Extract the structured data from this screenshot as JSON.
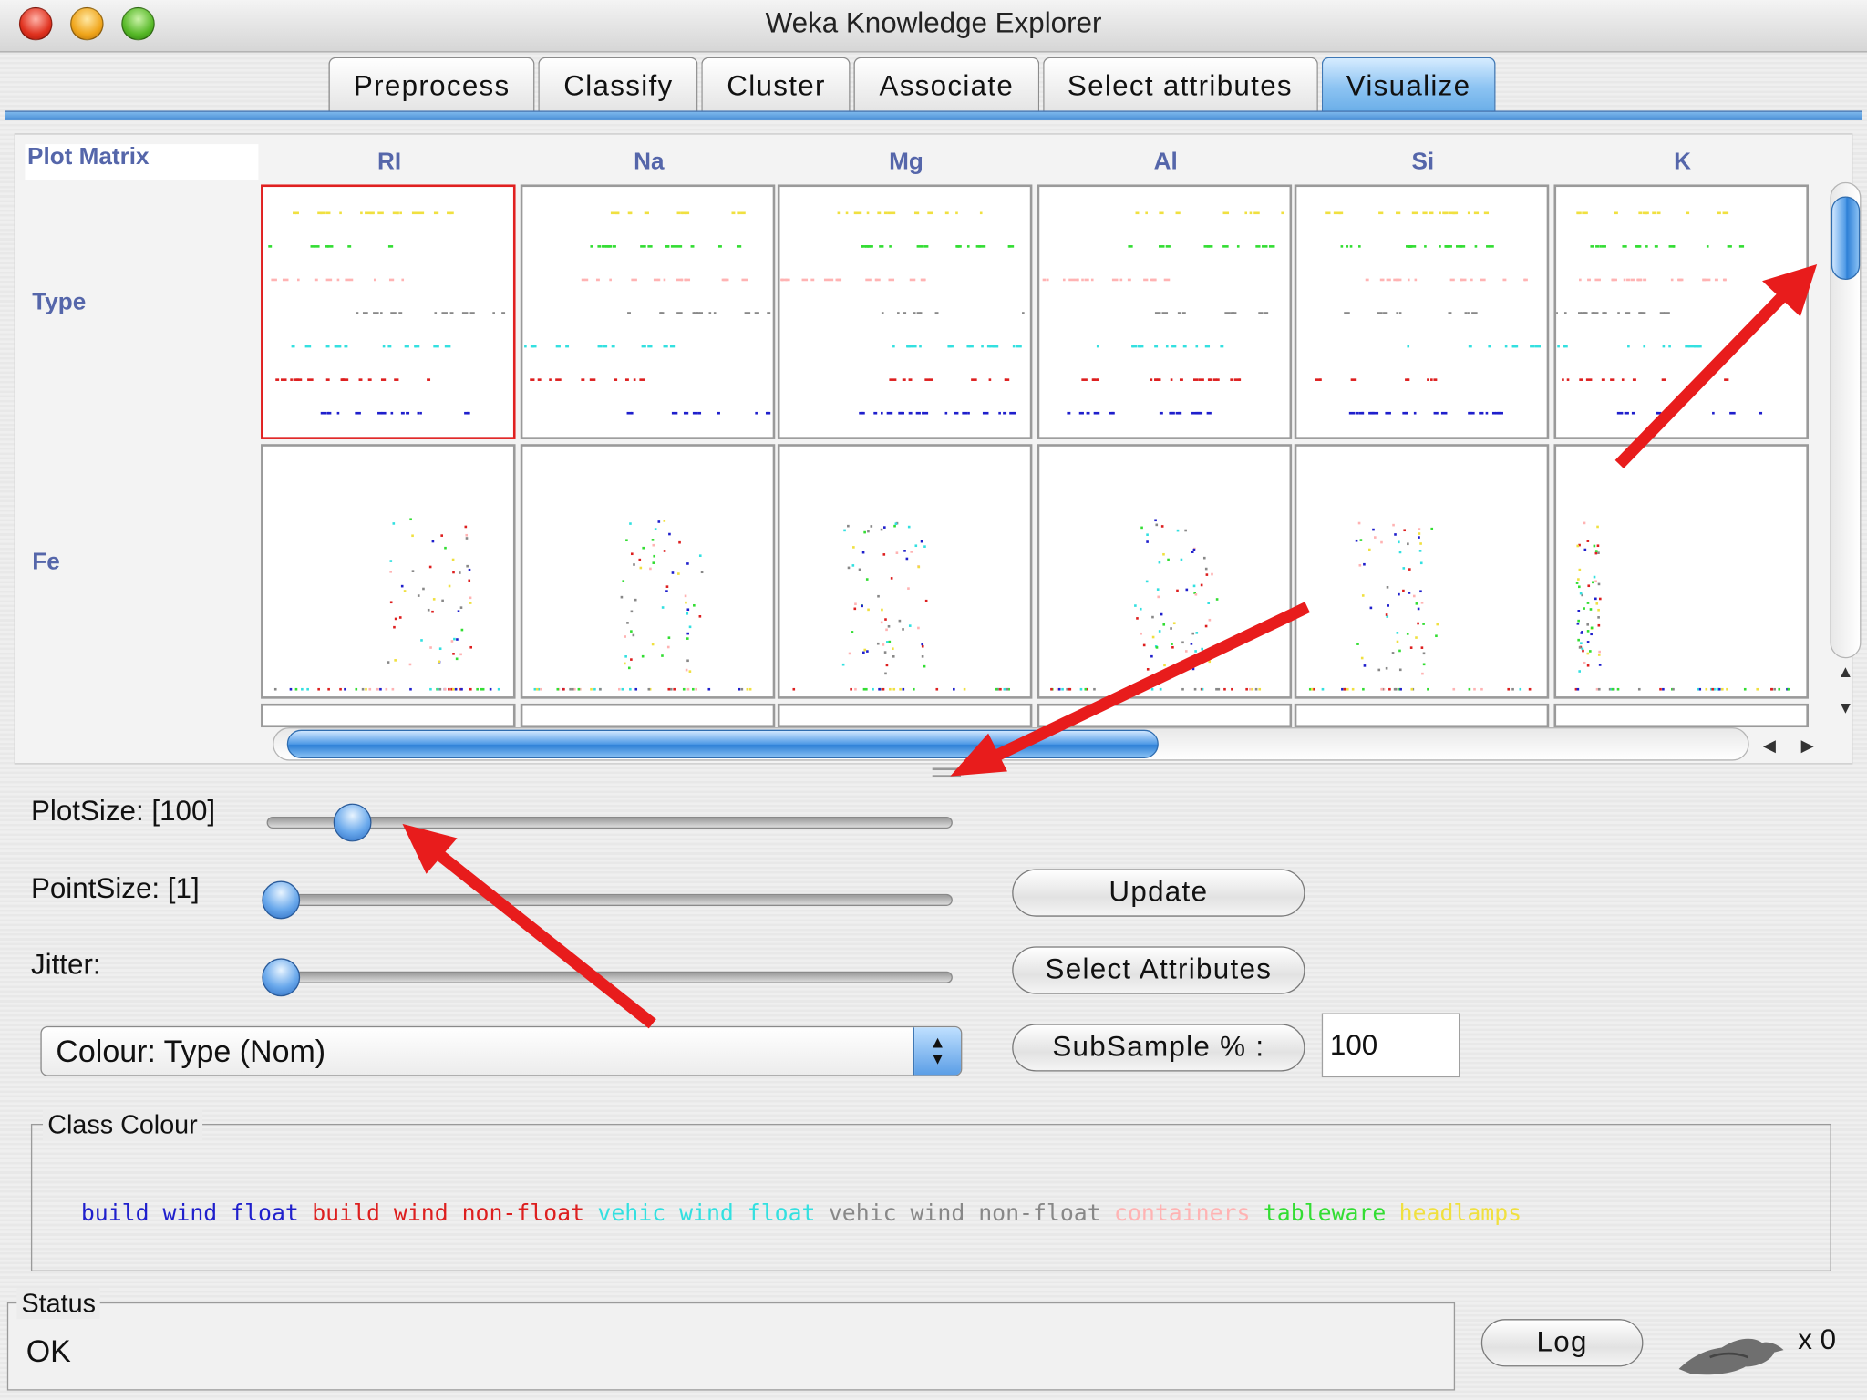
{
  "window": {
    "title": "Weka Knowledge Explorer"
  },
  "tabs": [
    {
      "label": "Preprocess",
      "active": false
    },
    {
      "label": "Classify",
      "active": false
    },
    {
      "label": "Cluster",
      "active": false
    },
    {
      "label": "Associate",
      "active": false
    },
    {
      "label": "Select attributes",
      "active": false
    },
    {
      "label": "Visualize",
      "active": true
    }
  ],
  "plot_matrix": {
    "label": "Plot Matrix",
    "columns": [
      "RI",
      "Na",
      "Mg",
      "Al",
      "Si",
      "K"
    ],
    "rows": [
      "Type",
      "Fe"
    ],
    "selected_cell": "Type x RI"
  },
  "controls": {
    "plot_size_label": "PlotSize: [100]",
    "plot_size_value": 100,
    "point_size_label": "PointSize: [1]",
    "point_size_value": 1,
    "jitter_label": "Jitter:",
    "jitter_value": 0,
    "update_label": "Update",
    "select_attributes_label": "Select Attributes",
    "subsample_label": "SubSample % :",
    "subsample_value": "100",
    "colour_select": "Colour: Type  (Nom)"
  },
  "class_colour": {
    "legend": "Class Colour",
    "classes": [
      {
        "name": "build wind float",
        "color": "#1f1fcc"
      },
      {
        "name": "build wind non-float",
        "color": "#dd1f1f"
      },
      {
        "name": "vehic wind float",
        "color": "#33e0e0"
      },
      {
        "name": "vehic wind non-float",
        "color": "#888888"
      },
      {
        "name": "containers",
        "color": "#ffb3b3"
      },
      {
        "name": "tableware",
        "color": "#33dd33"
      },
      {
        "name": "headlamps",
        "color": "#f0e040"
      }
    ]
  },
  "status": {
    "legend": "Status",
    "text": "OK",
    "log_label": "Log",
    "x_count": "x 0"
  },
  "icons": {
    "bird": "weka-bird-icon",
    "close": "close-icon",
    "minimize": "minimize-icon",
    "zoom": "zoom-icon"
  }
}
